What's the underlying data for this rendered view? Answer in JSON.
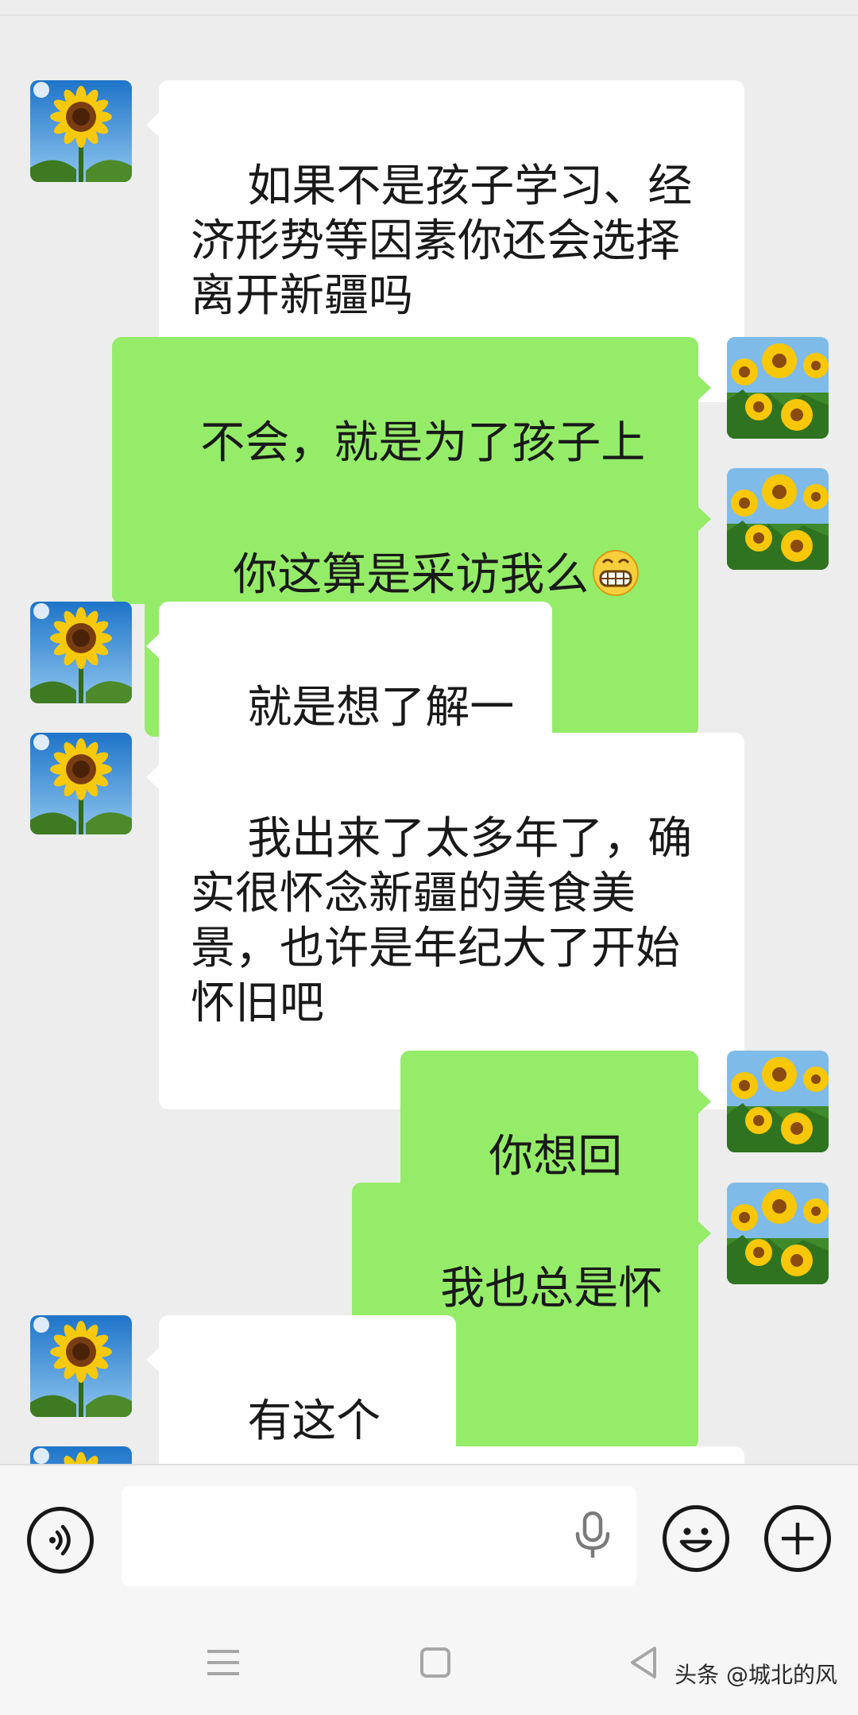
{
  "conversation": {
    "messages": [
      {
        "side": "in",
        "text": "如果不是孩子学习、经济形势等因素你还会选择离开新疆吗"
      },
      {
        "side": "out",
        "text": "不会，就是为了孩子上学"
      },
      {
        "side": "out",
        "text": "你这算是采访我么",
        "emoji_count": 2,
        "emoji": "grinning-face-icon"
      },
      {
        "side": "in",
        "text": "就是想了解一下"
      },
      {
        "side": "in",
        "text": "我出来了太多年了，确实很怀念新疆的美食美景，也许是年纪大了开始怀旧吧"
      },
      {
        "side": "out",
        "text": "你想回去么"
      },
      {
        "side": "out",
        "text": "我也总是怀念"
      },
      {
        "side": "in",
        "text": "有这个想法"
      }
    ]
  },
  "input_bar": {
    "value": "",
    "icons": [
      "voice-input-icon",
      "microphone-icon",
      "emoji-icon",
      "add-icon"
    ]
  },
  "nav_bar": {
    "icons": [
      "menu-icon",
      "home-icon",
      "back-icon"
    ],
    "watermark": "头条 @城北的风"
  },
  "colors": {
    "background": "#ededed",
    "incoming_bubble": "#ffffff",
    "outgoing_bubble": "#95ec69",
    "text": "#191919"
  }
}
